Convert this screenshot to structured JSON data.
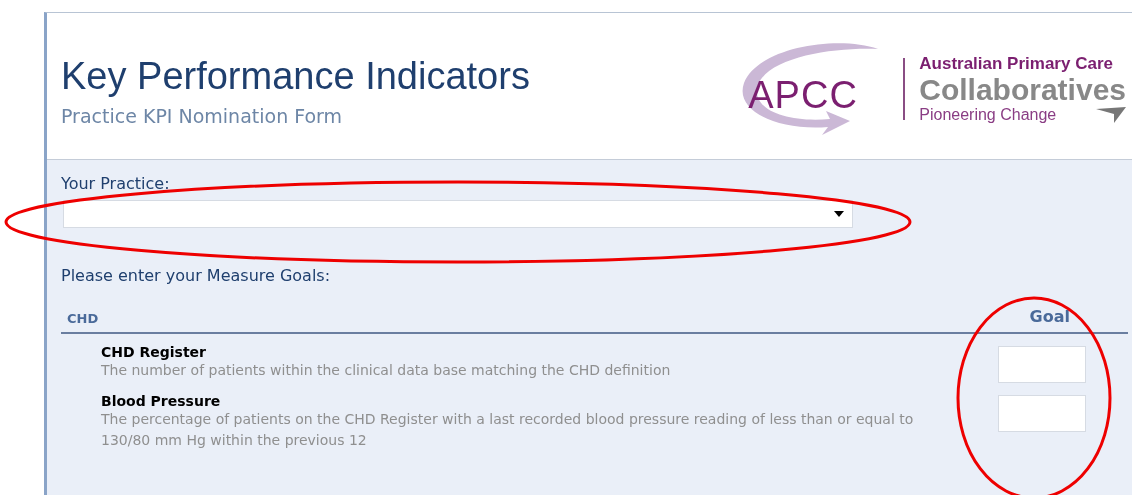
{
  "header": {
    "title": "Key Performance Indicators",
    "subtitle": "Practice KPI Nomination Form"
  },
  "logo": {
    "mark": "APCC",
    "line_1": "Australian Primary Care",
    "line_2": "Collaboratives",
    "tagline": "Pioneering Change"
  },
  "practice": {
    "label": "Your Practice:"
  },
  "measures": {
    "prompt": "Please enter your Measure Goals:",
    "section": "CHD",
    "goal_heading": "Goal",
    "rows": [
      {
        "name": "CHD Register",
        "description": "The number of patients within the clinical data base matching the CHD definition"
      },
      {
        "name": "Blood Pressure",
        "description": "The percentage of patients on the CHD Register with a last recorded blood pressure reading of less than or equal to 130/80 mm Hg within the previous 12"
      }
    ]
  },
  "annotations": [
    {
      "kind": "ellipse"
    },
    {
      "kind": "ellipse"
    }
  ]
}
